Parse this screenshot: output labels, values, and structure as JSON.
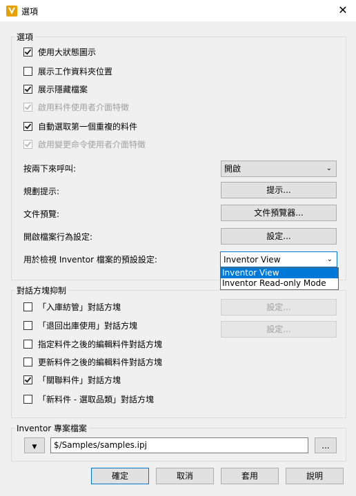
{
  "window": {
    "title": "選項",
    "close_symbol": "✕"
  },
  "options_group": {
    "label": "選項",
    "checkboxes": [
      {
        "label": "使用大狀態圖示",
        "checked": true,
        "enabled": true
      },
      {
        "label": "展示工作資料夾位置",
        "checked": false,
        "enabled": true
      },
      {
        "label": "展示隱藏檔案",
        "checked": true,
        "enabled": true
      },
      {
        "label": "啟用料件使用者介面特徵",
        "checked": true,
        "enabled": false
      },
      {
        "label": "自動選取第一個重複的料件",
        "checked": true,
        "enabled": true
      },
      {
        "label": "啟用變更命令使用者介面特徵",
        "checked": true,
        "enabled": false
      }
    ],
    "double_click": {
      "label": "按兩下來呼叫:",
      "value": "開啟"
    },
    "planning_hint": {
      "label": "規劃提示:",
      "button": "提示..."
    },
    "file_preview": {
      "label": "文件預覽:",
      "button": "文件預覽器..."
    },
    "open_behavior": {
      "label": "開啟檔案行為設定:",
      "button": "設定..."
    },
    "default_view": {
      "label": "用於檢視 Inventor 檔案的預設設定:",
      "value": "Inventor View",
      "options": [
        "Inventor View",
        "Inventor Read-only Mode"
      ]
    }
  },
  "dialog_group": {
    "label": "對話方塊抑制",
    "items": [
      {
        "label": "「入庫紡管」對話方塊",
        "checked": false,
        "button": "設定..."
      },
      {
        "label": "「退回出庫使用」對話方塊",
        "checked": false,
        "button": "設定..."
      },
      {
        "label": "指定料件之後的編輯料件對話方塊",
        "checked": false
      },
      {
        "label": "更新料件之後的編輯料件對話方塊",
        "checked": false
      },
      {
        "label": "「關聯料件」對話方塊",
        "checked": true
      },
      {
        "label": "「新料件 - 選取品類」對話方塊",
        "checked": false
      }
    ]
  },
  "project_group": {
    "label": "Inventor 專案檔案",
    "path": "$/Samples/samples.ipj",
    "browse_label": "..."
  },
  "footer": {
    "ok": "確定",
    "cancel": "取消",
    "apply": "套用",
    "help": "說明"
  },
  "colors": {
    "accent": "#0078d7",
    "app_icon": "#e8a000"
  }
}
